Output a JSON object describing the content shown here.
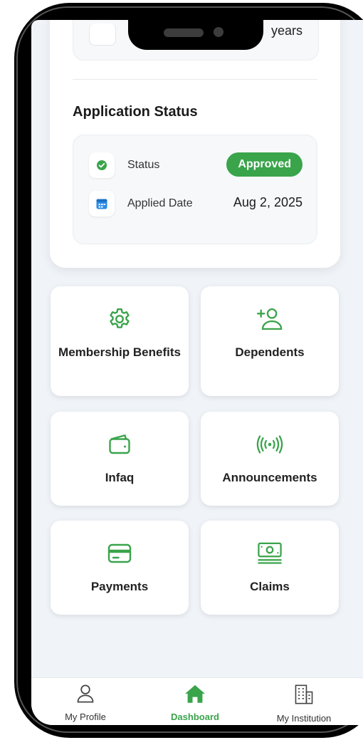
{
  "previous_section": {
    "value_fragment": "years"
  },
  "application_status": {
    "title": "Application Status",
    "status_label": "Status",
    "status_value": "Approved",
    "applied_date_label": "Applied Date",
    "applied_date_value": "Aug 2, 2025"
  },
  "tiles": [
    {
      "label": "Membership Benefits",
      "icon": "gear-icon"
    },
    {
      "label": "Dependents",
      "icon": "add-user-icon"
    },
    {
      "label": "Infaq",
      "icon": "wallet-icon"
    },
    {
      "label": "Announcements",
      "icon": "broadcast-icon"
    },
    {
      "label": "Payments",
      "icon": "card-icon"
    },
    {
      "label": "Claims",
      "icon": "money-icon"
    }
  ],
  "bottom_nav": {
    "items": [
      {
        "label": "My Profile",
        "icon": "user-icon"
      },
      {
        "label": "Dashboard",
        "icon": "home-icon",
        "active": true
      },
      {
        "label": "My Institution",
        "icon": "building-icon"
      }
    ]
  },
  "colors": {
    "accent": "#3aa44b",
    "background": "#f0f4f8",
    "card": "#ffffff"
  }
}
